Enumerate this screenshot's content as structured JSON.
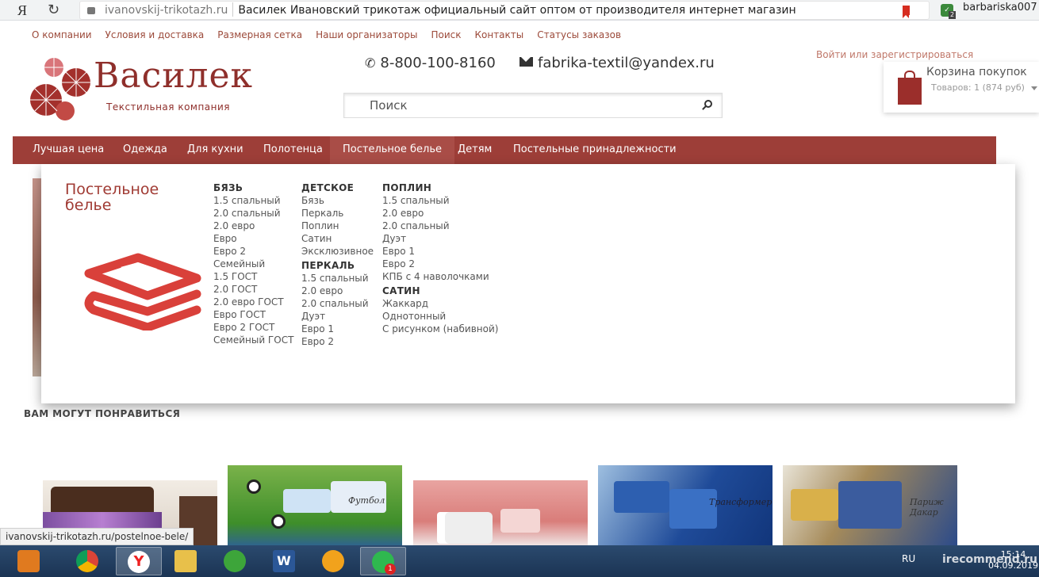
{
  "browser": {
    "yandex_glyph": "Я",
    "url": "ivanovskij-trikotazh.ru",
    "page_title": "Василек Ивановский трикотаж официальный сайт оптом от производителя интернет магазин",
    "extension_badge": "2",
    "username": "barbariska007"
  },
  "top_links": [
    "О компании",
    "Условия и доставка",
    "Размерная сетка",
    "Наши организаторы",
    "Поиск",
    "Контакты",
    "Статусы заказов"
  ],
  "logo": {
    "title": "Василек",
    "subtitle": "Текстильная компания"
  },
  "contacts": {
    "phone": "8-800-100-8160",
    "email": "fabrika-textil@yandex.ru"
  },
  "search": {
    "placeholder": "Поиск"
  },
  "auth": {
    "login_link": "Войти или зарегистрироваться"
  },
  "cart": {
    "title": "Корзина покупок",
    "info": "Товаров: 1 (874 руб)"
  },
  "main_nav": [
    "Лучшая цена",
    "Одежда",
    "Для кухни",
    "Полотенца",
    "Постельное белье",
    "Детям",
    "Постельные принадлежности"
  ],
  "mega_menu": {
    "title": "Постельное белье",
    "col1": {
      "heading": "БЯЗЬ",
      "items": [
        "1.5 спальный",
        "2.0 спальный",
        "2.0 евро",
        "Евро",
        "Евро 2",
        "Семейный",
        "1.5 ГОСТ",
        "2.0 ГОСТ",
        "2.0 евро ГОСТ",
        "Евро ГОСТ",
        "Евро 2 ГОСТ",
        "Семейный ГОСТ"
      ]
    },
    "col2": {
      "heading": "ДЕТСКОЕ",
      "items": [
        "Бязь",
        "Перкаль",
        "Поплин",
        "Сатин",
        "Эксклюзивное"
      ],
      "heading2": "ПЕРКАЛЬ",
      "items2": [
        "1.5 спальный",
        "2.0 евро",
        "2.0 спальный",
        "Дуэт",
        "Евро 1",
        "Евро 2"
      ]
    },
    "col3": {
      "heading": "ПОПЛИН",
      "items": [
        "1.5 спальный",
        "2.0 евро",
        "2.0 спальный",
        "Дуэт",
        "Евро 1",
        "Евро 2",
        "КПБ с 4 наволочками"
      ],
      "heading2": "САТИН",
      "items2": [
        "Жаккард",
        "Однотонный",
        "С рисунком (набивной)"
      ]
    }
  },
  "recommend": {
    "title": "ВАМ МОГУТ ПОНРАВИТЬСЯ",
    "thumb_labels": [
      "Футбол",
      "Трансформеры",
      "Париж Дакар"
    ]
  },
  "status_url": "ivanovskij-trikotazh.ru/postelnoe-bele/",
  "taskbar": {
    "whatsapp_badge": "1",
    "lang": "RU",
    "watermark": "irecommend.ru",
    "time": "15:14",
    "date": "04.09.2019"
  },
  "colors": {
    "brand": "#9d3e38",
    "link": "#9c4a3a",
    "title": "#a03a33"
  }
}
